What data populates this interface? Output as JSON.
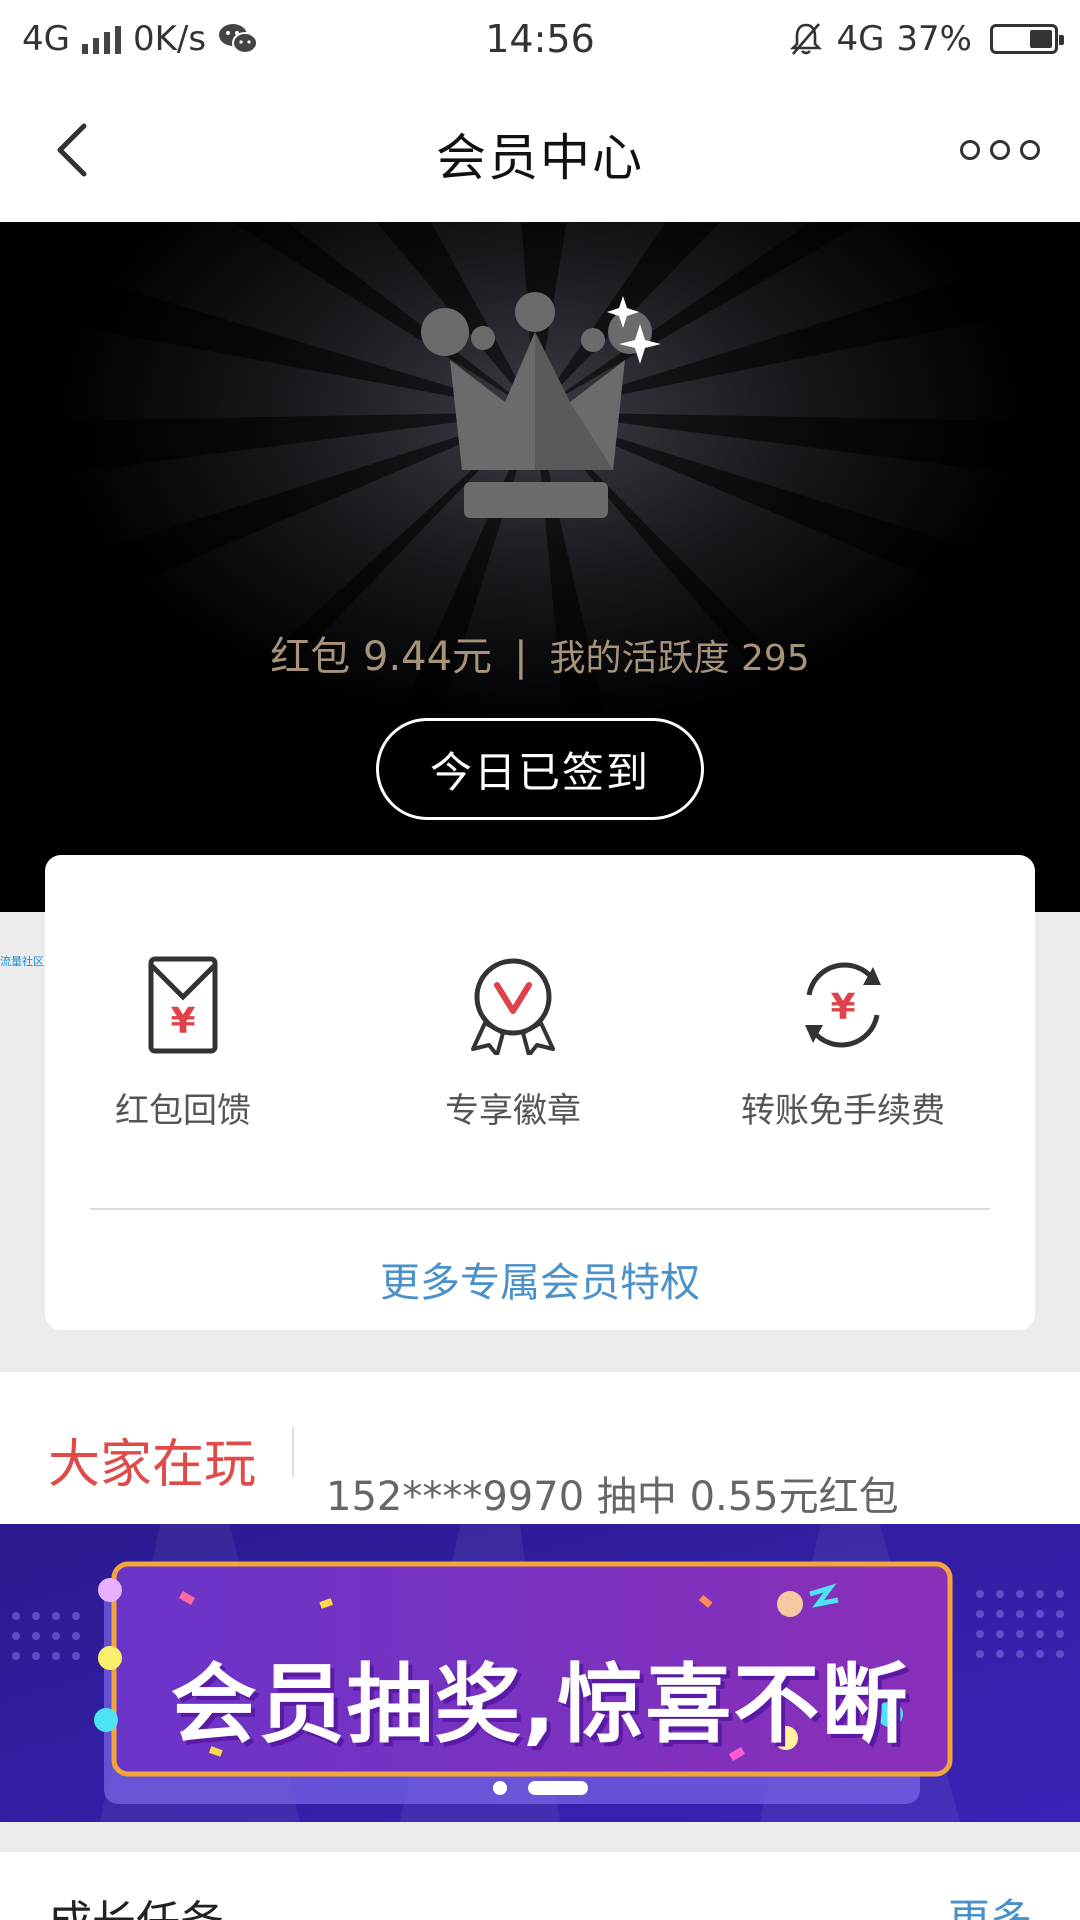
{
  "status_bar": {
    "network": "4G",
    "speed": "0K/s",
    "time": "14:56",
    "network_right": "4G",
    "battery": "37%"
  },
  "nav": {
    "title": "会员中心"
  },
  "hero": {
    "red_packet": "红包 9.44元",
    "separator": "|",
    "activity": "我的活跃度 295",
    "signin_button": "今日已签到"
  },
  "privileges": {
    "items": [
      {
        "label": "红包回馈",
        "icon": "red-envelope-icon"
      },
      {
        "label": "专享徽章",
        "icon": "badge-icon"
      },
      {
        "label": "转账免手续费",
        "icon": "yuan-exchange-icon"
      }
    ],
    "more_link": "更多专属会员特权",
    "side_tag": "流量社区"
  },
  "playing": {
    "title": "大家在玩",
    "ticker": "152****9970 抽中 0.55元红包"
  },
  "banner": {
    "text": "会员抽奖,惊喜不断"
  },
  "growth": {
    "title": "成长任务",
    "more": "更多"
  },
  "colors": {
    "accent_red": "#e04a48",
    "link_blue": "#4a90c9",
    "gold_text": "#a7927a",
    "banner_purple": "#3b1fa6"
  }
}
